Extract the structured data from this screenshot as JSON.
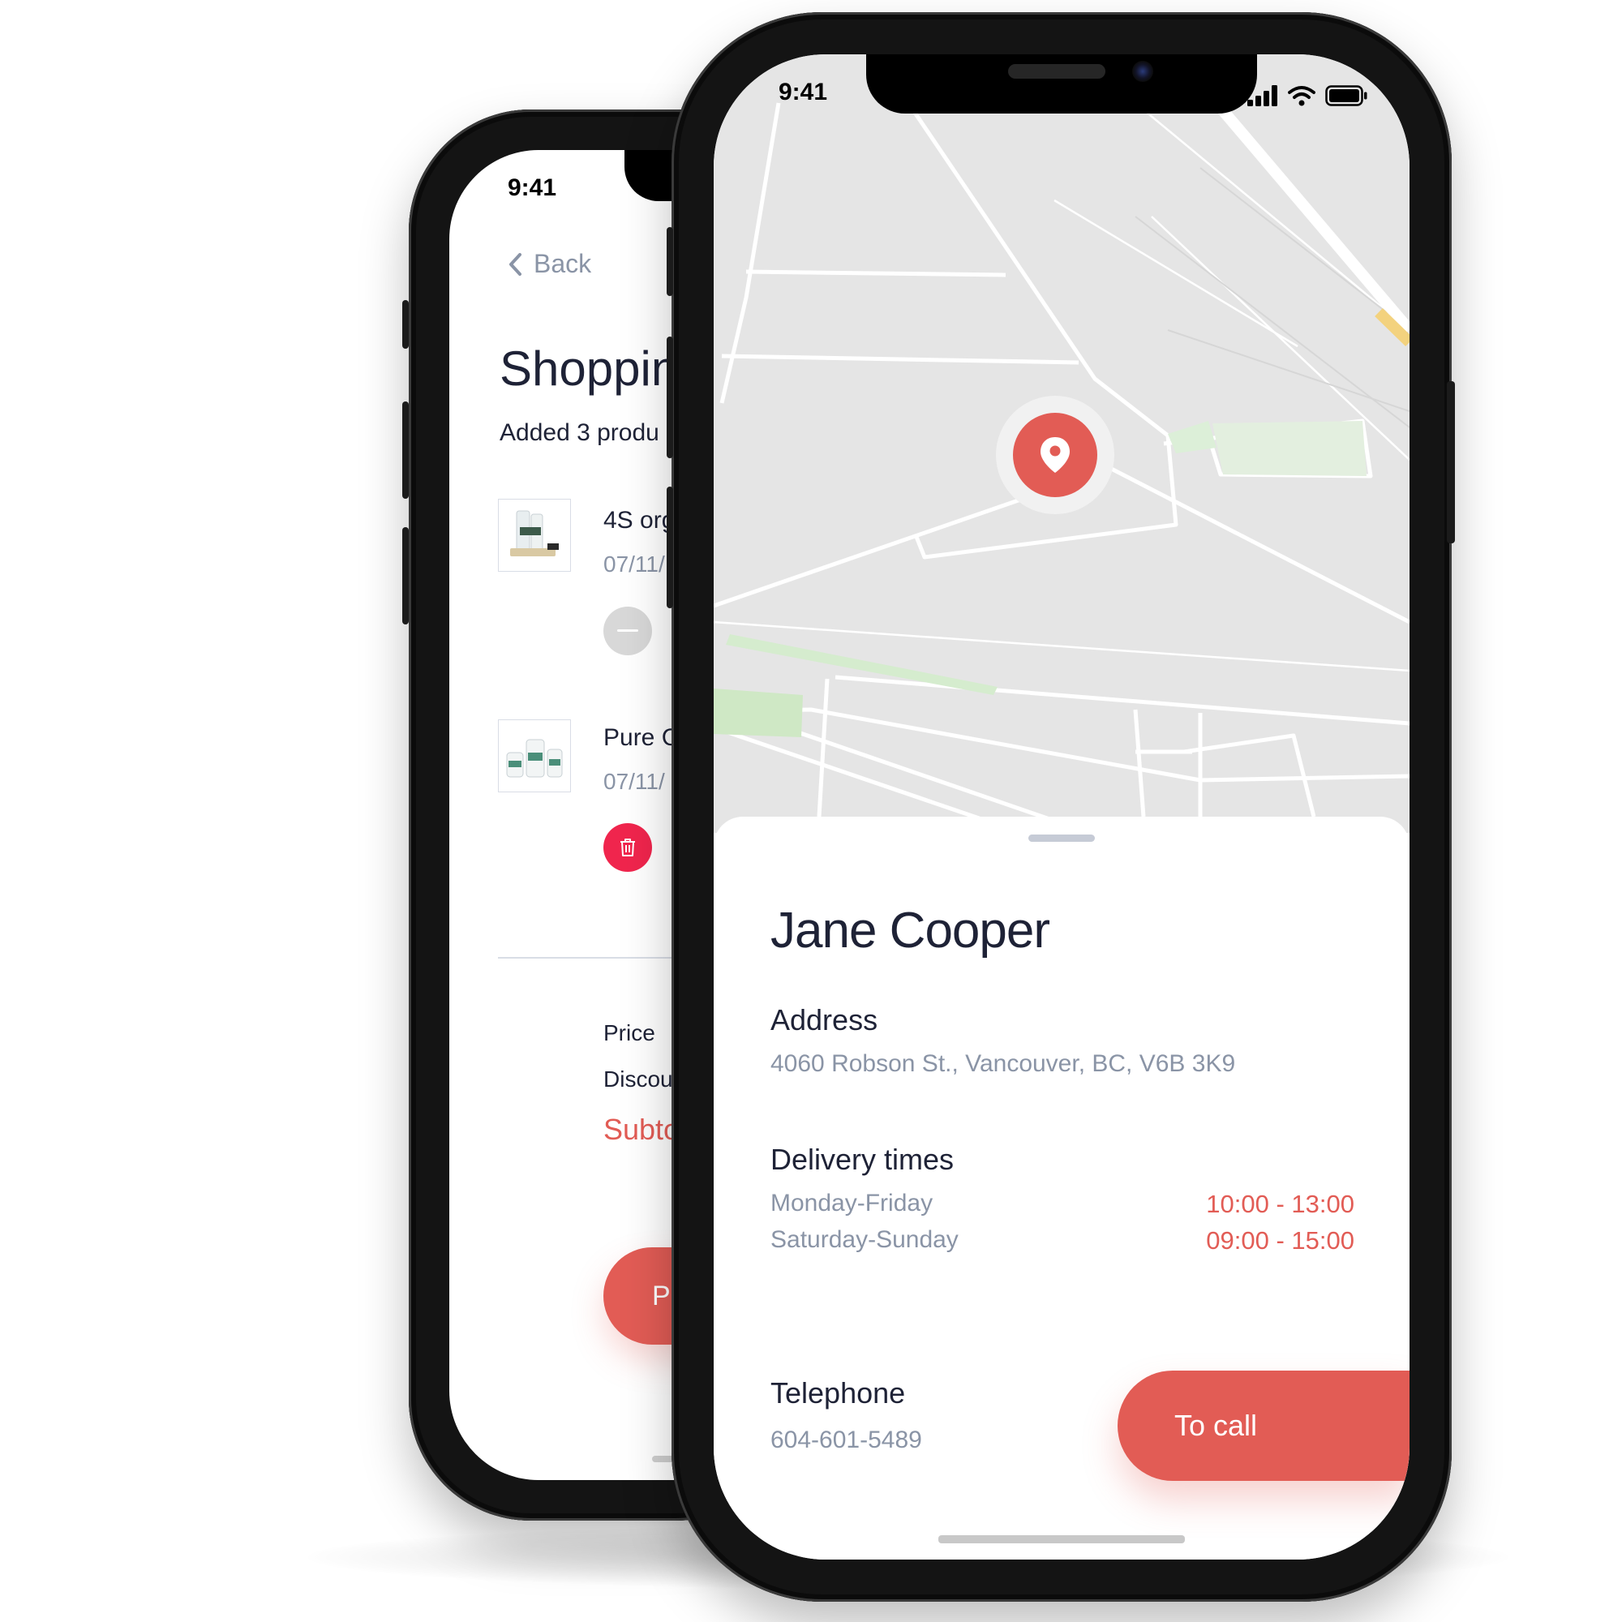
{
  "shopping_screen": {
    "status_time": "9:41",
    "back_label": "Back",
    "title": "Shoppin",
    "subtitle": "Added 3 produ",
    "items": [
      {
        "name": "4S org",
        "date": "07/11/"
      },
      {
        "name": "Pure C",
        "date": "07/11/"
      }
    ],
    "summary": {
      "price_label": "Price",
      "discount_label": "Discou",
      "subtotal_label": "Subto"
    },
    "pay_button_label": "P"
  },
  "delivery_screen": {
    "status_time": "9:41",
    "contact_name": "Jane Cooper",
    "address": {
      "heading": "Address",
      "value": "4060  Robson St., Vancouver, BC, V6B 3K9"
    },
    "delivery_times": {
      "heading": "Delivery times",
      "rows": [
        {
          "days": "Monday-Friday",
          "hours": "10:00 - 13:00"
        },
        {
          "days": "Saturday-Sunday",
          "hours": "09:00 - 15:00"
        }
      ]
    },
    "telephone": {
      "heading": "Telephone",
      "value": "604-601-5489"
    },
    "call_button_label": "To call"
  },
  "colors": {
    "accent": "#e25c55",
    "title_text": "#1e2236",
    "muted_text": "#8a94a6",
    "map_background": "#e5e5e5",
    "delete_button": "#f0254d"
  }
}
